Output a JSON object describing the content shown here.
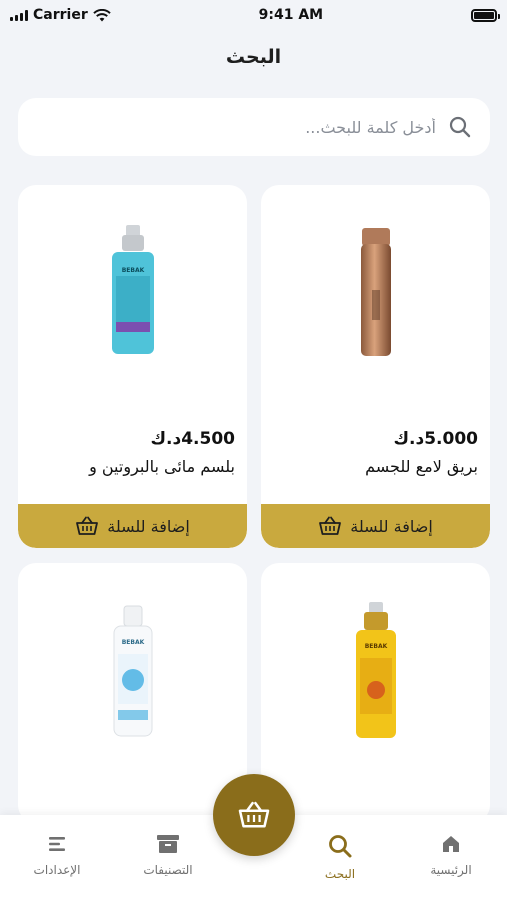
{
  "status_bar": {
    "carrier": "Carrier",
    "time": "9:41 AM"
  },
  "header": {
    "title": "البحث"
  },
  "search": {
    "placeholder": "أدخل كلمة للبحث..."
  },
  "products": [
    {
      "price": "5.000د.ك",
      "name": "بريق لامع للجسم",
      "add_label": "إضافة للسلة",
      "brand": ""
    },
    {
      "price": "4.500د.ك",
      "name": "بلسم مائى بالبروتين و",
      "add_label": "إضافة للسلة",
      "brand": "BEBAK"
    },
    {
      "price": "",
      "name": "",
      "add_label": "",
      "brand": "BEBAK"
    },
    {
      "price": "",
      "name": "",
      "add_label": "",
      "brand": "BEBAK"
    }
  ],
  "tab_bar": {
    "tabs": [
      {
        "label": "الرئيسية",
        "icon": "home-icon"
      },
      {
        "label": "البحث",
        "icon": "search-icon"
      },
      {
        "label": "التصنيفات",
        "icon": "categories-icon"
      },
      {
        "label": "الإعدادات",
        "icon": "settings-menu-icon"
      }
    ],
    "cart_icon": "basket-icon"
  },
  "colors": {
    "accent": "#c9a93e",
    "accent_dark": "#8a6d1b",
    "background": "#f2f4f8"
  }
}
